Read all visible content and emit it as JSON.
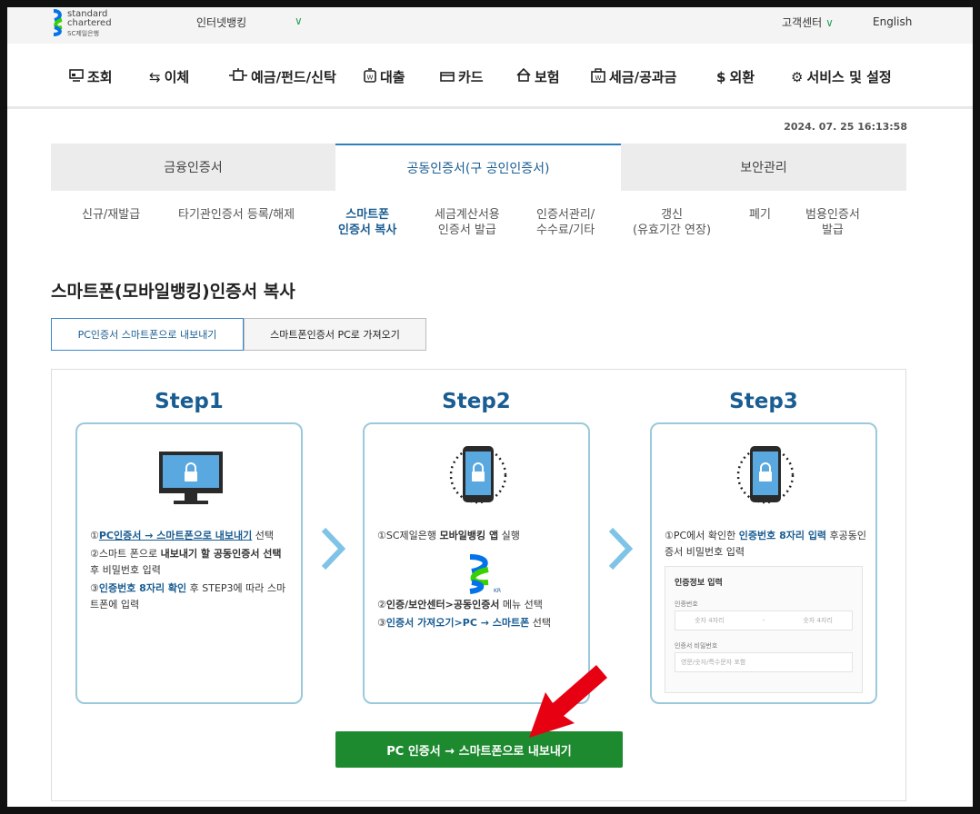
{
  "header": {
    "logo": {
      "line1": "standard",
      "line2": "chartered",
      "line3": "SC제일은행"
    },
    "menu_select": "인터넷뱅킹",
    "customer_center": "고객센터",
    "english": "English"
  },
  "gnb": [
    {
      "label": "조회",
      "icon": "monitor-icon"
    },
    {
      "label": "이체",
      "icon": "transfer-icon"
    },
    {
      "label": "예금/펀드/신탁",
      "icon": "deposit-icon"
    },
    {
      "label": "대출",
      "icon": "loan-icon"
    },
    {
      "label": "카드",
      "icon": "card-icon"
    },
    {
      "label": "보험",
      "icon": "house-icon"
    },
    {
      "label": "세금/공과금",
      "icon": "tax-icon"
    },
    {
      "label": "외환",
      "icon": "dollar-icon"
    },
    {
      "label": "서비스 및 설정",
      "icon": "gear-icon"
    }
  ],
  "timestamp": "2024. 07. 25 16:13:58",
  "tabs": [
    "금융인증서",
    "공동인증서(구 공인인증서)",
    "보안관리"
  ],
  "subtabs": [
    "신규/재발급",
    "타기관인증서 등록/해제",
    "스마트폰\n인증서 복사",
    "세금계산서용\n인증서 발급",
    "인증서관리/\n수수료/기타",
    "갱신\n(유효기간 연장)",
    "폐기",
    "범용인증서\n발급"
  ],
  "page_title": "스마트폰(모바일뱅킹)인증서 복사",
  "button_tabs": [
    "PC인증서 스마트폰으로 내보내기",
    "스마트폰인증서 PC로 가져오기"
  ],
  "steps": [
    {
      "title": "Step1",
      "lines": {
        "s1_pre": "①",
        "s1_link": "PC인증서 → 스마트폰으로 내보내기",
        "s1_post": " 선택",
        "s2_pre": "②스마트 폰으로 ",
        "s2_bold": "내보내기 할 공동인증서 선택",
        "s2_post": " 후 비밀번호 입력",
        "s3_pre": "③",
        "s3_bold": "인증번호 8자리 확인",
        "s3_post": " 후 STEP3에 따라 스마트폰에 입력"
      }
    },
    {
      "title": "Step2",
      "lines": {
        "s1_pre": "①SC제일은행 ",
        "s1_bold": "모바일뱅킹 앱",
        "s1_post": " 실행",
        "app_badge": "KR",
        "s2_pre": "②",
        "s2_bold": "인증/보안센터>공동인증서",
        "s2_post": " 메뉴 선택",
        "s3_pre": "③",
        "s3_bold": "인증서 가져오기>PC → 스마트폰",
        "s3_post": " 선택"
      }
    },
    {
      "title": "Step3",
      "lines": {
        "s1_pre": "①PC에서 확인한 ",
        "s1_bold": "인증번호 8자리 입력",
        "s1_post": " 후공동인증서 비밀번호 입력"
      },
      "form": {
        "heading": "인증정보 입력",
        "label1": "인증번호",
        "ph1a": "숫자 4자리",
        "ph_sep": "-",
        "ph1b": "숫자 4자리",
        "label2": "인증서 비밀번호",
        "ph2": "영문/숫자/특수문자 포함"
      }
    }
  ],
  "cta_button": "PC 인증서 → 스마트폰으로 내보내기",
  "colors": {
    "brand_blue": "#1a5d92",
    "brand_green": "#1d8a2f",
    "accent_green": "#2aa05a",
    "arrow_blue": "#7fc3e6",
    "red": "#e60012"
  }
}
